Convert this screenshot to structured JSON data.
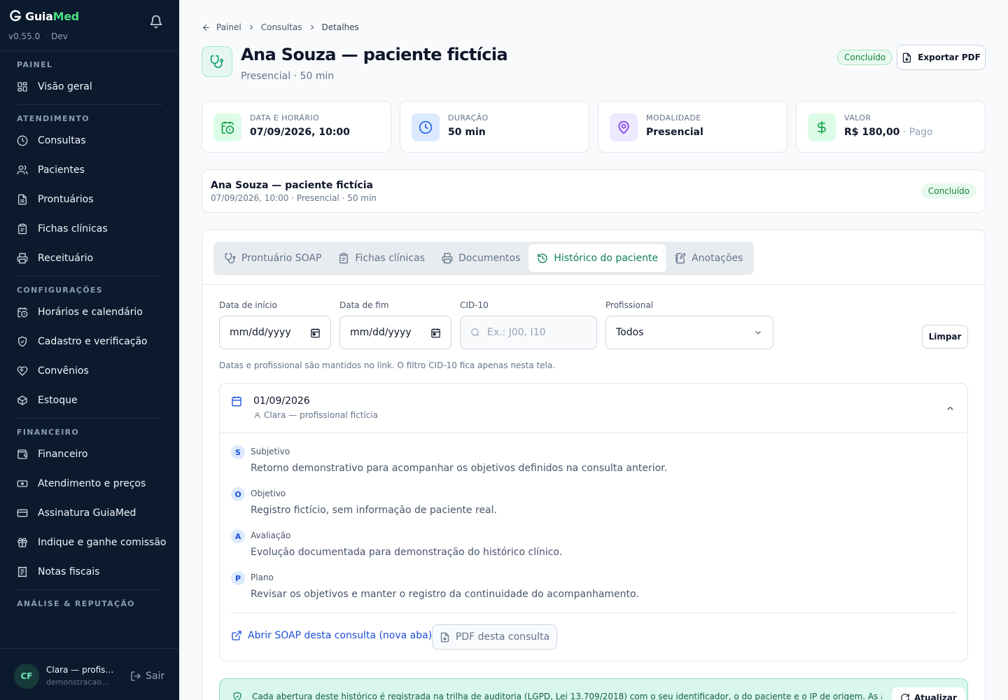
{
  "app": {
    "brand_a": "Guia",
    "brand_b": "Med",
    "version": "v0.55.0",
    "env": "Dev"
  },
  "sidebar": {
    "sections": [
      {
        "label": "PAINEL",
        "items": [
          {
            "label": "Visão geral",
            "icon": "grid-icon"
          }
        ]
      },
      {
        "label": "ATENDIMENTO",
        "items": [
          {
            "label": "Consultas",
            "icon": "clock-icon"
          },
          {
            "label": "Pacientes",
            "icon": "users-icon"
          },
          {
            "label": "Prontuários",
            "icon": "file-text-icon"
          },
          {
            "label": "Fichas clínicas",
            "icon": "clipboard-icon"
          },
          {
            "label": "Receituário",
            "icon": "printer-icon"
          }
        ]
      },
      {
        "label": "CONFIGURAÇÕES",
        "items": [
          {
            "label": "Horários e calendário",
            "icon": "calendar-clock-icon"
          },
          {
            "label": "Cadastro e verificação",
            "icon": "shield-check-icon"
          },
          {
            "label": "Convênios",
            "icon": "heart-handshake-icon"
          },
          {
            "label": "Estoque",
            "icon": "package-icon"
          }
        ]
      },
      {
        "label": "FINANCEIRO",
        "items": [
          {
            "label": "Financeiro",
            "icon": "wallet-icon"
          },
          {
            "label": "Atendimento e preços",
            "icon": "banknote-icon"
          },
          {
            "label": "Assinatura GuiaMed",
            "icon": "credit-card-icon"
          },
          {
            "label": "Indique e ganhe comissão",
            "icon": "gift-icon"
          },
          {
            "label": "Notas fiscais",
            "icon": "receipt-icon"
          }
        ]
      },
      {
        "label": "ANÁLISE & REPUTAÇÃO",
        "items": []
      }
    ],
    "user": {
      "initials": "CF",
      "name": "Clara — profissional fictícia",
      "email": "demonstracao@guiamed.app",
      "logout": "Sair"
    }
  },
  "breadcrumb": [
    "Painel",
    "Consultas",
    "Detalhes"
  ],
  "header": {
    "title": "Ana Souza — paciente fictícia",
    "subtitle": "Presencial · 50 min",
    "status": "Concluído",
    "export_label": "Exportar PDF"
  },
  "stats": [
    {
      "label": "DATA E HORÁRIO",
      "value": "07/09/2026, 10:00",
      "extra": "",
      "icon": "calendar-clock-icon",
      "color": "#16a34a",
      "bg": "#dcfce7"
    },
    {
      "label": "DURAÇÃO",
      "value": "50 min",
      "extra": "",
      "icon": "clock-icon",
      "color": "#2563eb",
      "bg": "#dbeafe"
    },
    {
      "label": "MODALIDADE",
      "value": "Presencial",
      "extra": "",
      "icon": "map-pin-icon",
      "color": "#7c3aed",
      "bg": "#ede9fe"
    },
    {
      "label": "VALOR",
      "value": "R$ 180,00",
      "extra": " · Pago",
      "icon": "dollar-icon",
      "color": "#16a34a",
      "bg": "#dcfce7"
    }
  ],
  "summary": {
    "title": "Ana Souza — paciente fictícia",
    "meta": "07/09/2026, 10:00 · Presencial · 50 min",
    "status": "Concluído"
  },
  "tabs": [
    {
      "label": "Prontuário SOAP",
      "icon": "stethoscope-icon",
      "active": false
    },
    {
      "label": "Fichas clínicas",
      "icon": "clipboard-icon",
      "active": false
    },
    {
      "label": "Documentos",
      "icon": "printer-icon",
      "active": false
    },
    {
      "label": "Histórico do paciente",
      "icon": "history-icon",
      "active": true
    },
    {
      "label": "Anotações",
      "icon": "edit-note-icon",
      "active": false
    }
  ],
  "filters": {
    "start_label": "Data de início",
    "start_value": "mm/dd/yyyy",
    "end_label": "Data de fim",
    "end_value": "mm/dd/yyyy",
    "cid_label": "CID-10",
    "cid_placeholder": "Ex.: J00, I10",
    "prof_label": "Profissional",
    "prof_value": "Todos",
    "clear_label": "Limpar",
    "hint": "Datas e profissional são mantidos no link. O filtro CID-10 fica apenas nesta tela."
  },
  "history_entry": {
    "date": "01/09/2026",
    "professional": "Clara — profissional fictícia",
    "soap": [
      {
        "letter": "S",
        "title": "Subjetivo",
        "text": "Retorno demonstrativo para acompanhar os objetivos definidos na consulta anterior."
      },
      {
        "letter": "O",
        "title": "Objetivo",
        "text": "Registro fictício, sem informação de paciente real."
      },
      {
        "letter": "A",
        "title": "Avaliação",
        "text": "Evolução documentada para demonstração do histórico clínico."
      },
      {
        "letter": "P",
        "title": "Plano",
        "text": "Revisar os objetivos e manter o registro da continuidade do acompanhamento."
      }
    ],
    "open_soap_label": "Abrir SOAP desta consulta (nova aba)",
    "pdf_label": "PDF desta consulta"
  },
  "audit": {
    "text": "Cada abertura deste histórico é registrada na trilha de auditoria (LGPD, Lei 13.709/2018) com o seu identificador, o do paciente e o IP de origem. As anotações",
    "button": "Atualizar"
  }
}
